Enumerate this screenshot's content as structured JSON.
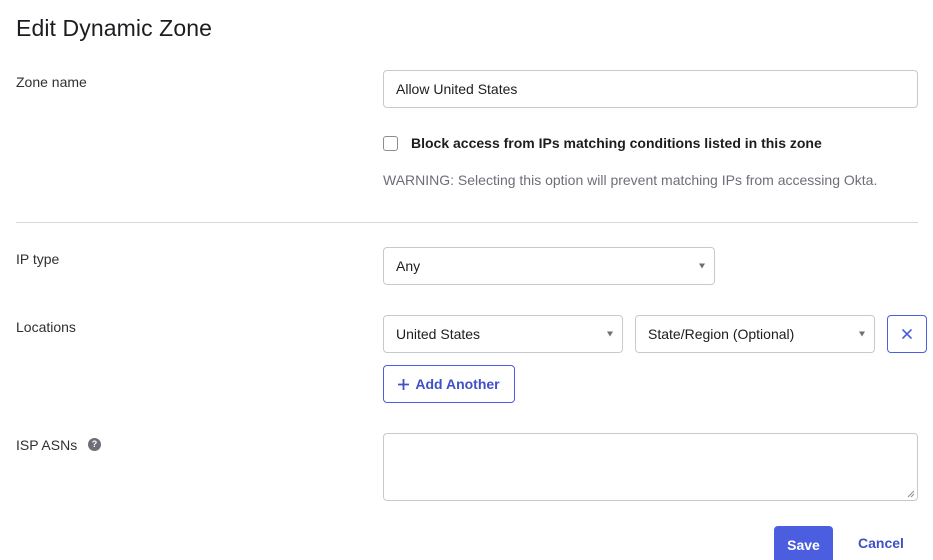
{
  "page": {
    "title": "Edit Dynamic Zone"
  },
  "zone_name": {
    "label": "Zone name",
    "value": "Allow United States"
  },
  "block_access": {
    "checked": false,
    "label": "Block access from IPs matching conditions listed in this zone",
    "warning": "WARNING: Selecting this option will prevent matching IPs from accessing Okta."
  },
  "ip_type": {
    "label": "IP type",
    "selected": "Any"
  },
  "locations": {
    "label": "Locations",
    "rows": [
      {
        "country": "United States",
        "region": "State/Region (Optional)"
      }
    ],
    "add_label": "Add Another"
  },
  "isp_asns": {
    "label": "ISP ASNs",
    "help_icon": "?",
    "value": ""
  },
  "actions": {
    "save_label": "Save",
    "cancel_label": "Cancel"
  },
  "colors": {
    "accent": "#4b5ee0",
    "border": "#c8c9cd",
    "text": "#1d1d21",
    "muted": "#6e6e78"
  },
  "icons": {
    "remove": "close-icon",
    "add": "plus-icon",
    "help": "help-circle-icon",
    "dropdown": "caret-down-icon"
  }
}
